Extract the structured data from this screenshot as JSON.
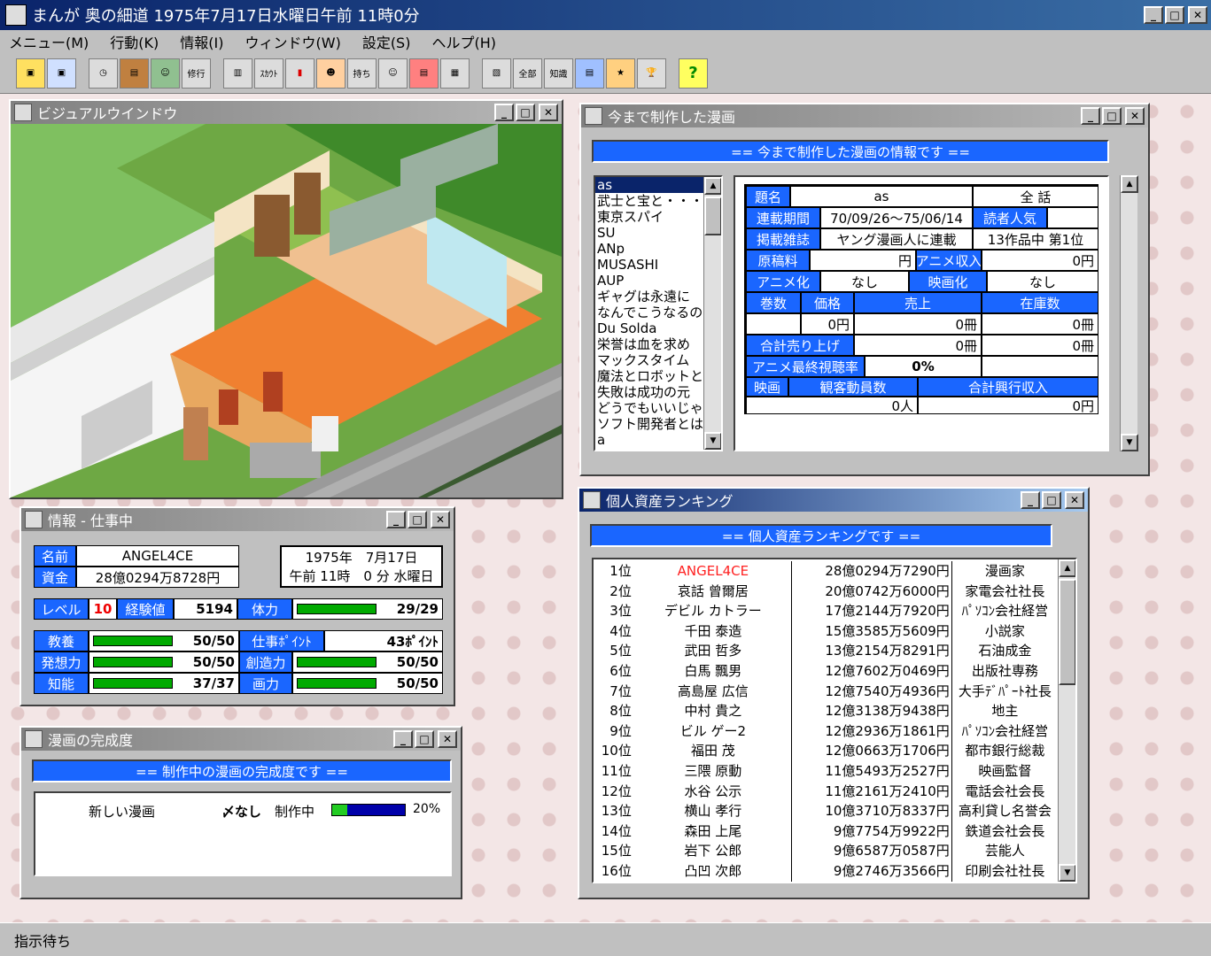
{
  "app": {
    "title": "まんが 奥の細道 1975年7月17日水曜日午前 11時0分"
  },
  "menu": [
    "メニュー(M)",
    "行動(K)",
    "情報(I)",
    "ウィンドウ(W)",
    "設定(S)",
    "ヘルプ(H)"
  ],
  "toolbar": {
    "labels": [
      "",
      "",
      "",
      "",
      "",
      "修行",
      "",
      "ｽｶｳﾄ",
      "",
      "",
      "持ち",
      "",
      "",
      "",
      "",
      "",
      "全部",
      "知識",
      "",
      "",
      "",
      "?"
    ]
  },
  "visual_window": {
    "title": "ビジュアルウインドウ"
  },
  "works_window": {
    "title": "今まで制作した漫画",
    "header": "== 今まで制作した漫画の情報です ==",
    "list": [
      "as",
      "武士と宝と・・・",
      "東京スパイ",
      "SU",
      "ANp",
      "MUSASHI",
      "AUP",
      "ギャグは永遠に",
      "なんでこうなるの",
      "Du Solda",
      "栄誉は血を求め",
      "マックスタイム",
      "魔法とロボットと",
      "失敗は成功の元",
      "どうでもいいじゃ",
      "ソフト開発者とは",
      "a"
    ],
    "detail": {
      "title_label": "題名",
      "title_value": "as",
      "episodes": "全 話",
      "period_label": "連載期間",
      "period_value": "70/09/26〜75/06/14",
      "popularity_label": "読者人気",
      "magazine_label": "掲載雑誌",
      "magazine_value": "ヤング漫画人に連載",
      "rank_value": "13作品中 第1位",
      "fee_label": "原稿料",
      "fee_value": "円",
      "anime_income_label": "アニメ収入",
      "anime_income_value": "0円",
      "anime_label": "アニメ化",
      "anime_value": "なし",
      "movie_label": "映画化",
      "movie_value": "なし",
      "volumes_label": "巻数",
      "price_label": "価格",
      "sales_label": "売上",
      "stock_label": "在庫数",
      "price_value": "0円",
      "sales_value": "0冊",
      "stock_value": "0冊",
      "total_sales_label": "合計売り上げ",
      "total_sales_value": "0冊",
      "total_stock_value": "0冊",
      "anime_rating_label": "アニメ最終視聴率",
      "anime_rating_value": "0%",
      "film_label": "映画",
      "audience_label": "観客動員数",
      "box_office_label": "合計興行収入",
      "audience_value": "0人",
      "box_office_value": "0円"
    }
  },
  "info_window": {
    "title": "情報 - 仕事中",
    "name_label": "名前",
    "name_value": "ANGEL4CE",
    "money_label": "資金",
    "money_value": "28億0294万8728円",
    "date": "1975年　7月17日",
    "time": "午前 11時　0 分 水曜日",
    "level_label": "レベル",
    "level_value": "10",
    "exp_label": "経験値",
    "exp_value": "5194",
    "hp_label": "体力",
    "hp_value": "29/29",
    "hp_fill": 1.0,
    "stats": [
      {
        "label": "教養",
        "value": "50/50",
        "fill": 1.0
      },
      {
        "label": "発想力",
        "value": "50/50",
        "fill": 1.0
      },
      {
        "label": "知能",
        "value": "37/37",
        "fill": 1.0
      }
    ],
    "work_points_label": "仕事ﾎﾟｲﾝﾄ",
    "work_points_value": "43ﾎﾟｲﾝﾄ",
    "stats2": [
      {
        "label": "創造力",
        "value": "50/50",
        "fill": 1.0
      },
      {
        "label": "画力",
        "value": "50/50",
        "fill": 1.0
      }
    ]
  },
  "progress_window": {
    "title": "漫画の完成度",
    "header": "== 制作中の漫画の完成度です ==",
    "item_name": "新しい漫画",
    "deadline": "〆なし",
    "status": "制作中",
    "percent": "20%",
    "fill": 0.2
  },
  "ranking_window": {
    "title": "個人資産ランキング",
    "header": "== 個人資産ランキングです ==",
    "rows": [
      {
        "pos": "1位",
        "name": "ANGEL4CE",
        "money": "28億0294万7290円",
        "job": "漫画家",
        "highlight": true
      },
      {
        "pos": "2位",
        "name": "哀話 曾爾居",
        "money": "20億0742万6000円",
        "job": "家電会社社長"
      },
      {
        "pos": "3位",
        "name": "デビル カトラー",
        "money": "17億2144万7920円",
        "job": "ﾊﾟｿｺﾝ会社経営"
      },
      {
        "pos": "4位",
        "name": "千田 泰造",
        "money": "15億3585万5609円",
        "job": "小説家"
      },
      {
        "pos": "5位",
        "name": "武田 哲多",
        "money": "13億2154万8291円",
        "job": "石油成金"
      },
      {
        "pos": "6位",
        "name": "白馬 飄男",
        "money": "12億7602万0469円",
        "job": "出版社専務"
      },
      {
        "pos": "7位",
        "name": "高島屋 広信",
        "money": "12億7540万4936円",
        "job": "大手ﾃﾞﾊﾟｰﾄ社長"
      },
      {
        "pos": "8位",
        "name": "中村 貴之",
        "money": "12億3138万9438円",
        "job": "地主"
      },
      {
        "pos": "9位",
        "name": "ビル ゲー2",
        "money": "12億2936万1861円",
        "job": "ﾊﾟｿｺﾝ会社経営"
      },
      {
        "pos": "10位",
        "name": "福田 茂",
        "money": "12億0663万1706円",
        "job": "都市銀行総裁"
      },
      {
        "pos": "11位",
        "name": "三隈 原動",
        "money": "11億5493万2527円",
        "job": "映画監督"
      },
      {
        "pos": "12位",
        "name": "水谷 公示",
        "money": "11億2161万2410円",
        "job": "電話会社会長"
      },
      {
        "pos": "13位",
        "name": "横山 孝行",
        "money": "10億3710万8337円",
        "job": "高利貸し名誉会"
      },
      {
        "pos": "14位",
        "name": "森田 上尾",
        "money": "9億7754万9922円",
        "job": "鉄道会社会長"
      },
      {
        "pos": "15位",
        "name": "岩下 公郎",
        "money": "9億6587万0587円",
        "job": "芸能人"
      },
      {
        "pos": "16位",
        "name": "凸凹 次郎",
        "money": "9億2746万3566円",
        "job": "印刷会社社長"
      }
    ]
  },
  "status": {
    "text": "指示待ち"
  },
  "colors": {
    "accent": "#1a66ff",
    "bar": "#00aa00",
    "highlight": "#ff2020",
    "title_active": "#0a246a"
  }
}
